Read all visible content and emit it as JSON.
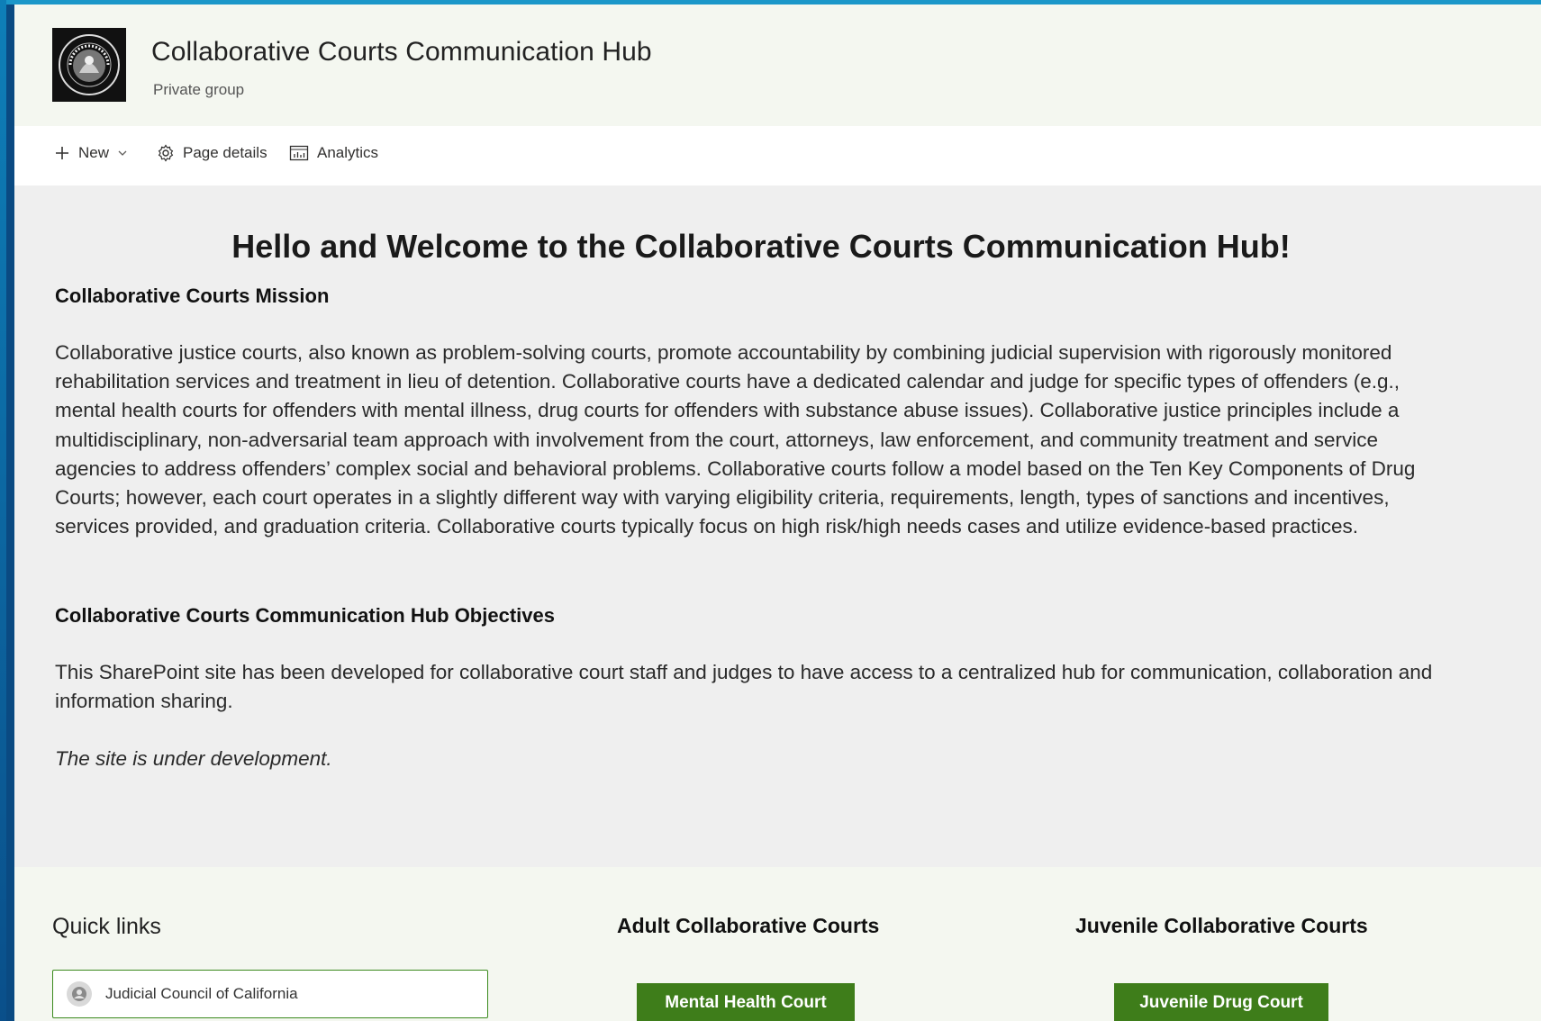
{
  "site": {
    "title": "Collaborative Courts Communication Hub",
    "subtitle": "Private group"
  },
  "command_bar": {
    "new_label": "New",
    "page_details_label": "Page details",
    "analytics_label": "Analytics"
  },
  "main": {
    "welcome": "Hello and Welcome to the Collaborative Courts Communication Hub!",
    "mission_heading": "Collaborative Courts Mission",
    "mission_text": "Collaborative justice courts, also known as problem-solving courts, promote accountability by combining judicial supervision with rigorously monitored rehabilitation services and treatment in lieu of detention. Collaborative courts have a dedicated calendar and judge for specific types of offenders (e.g., mental health courts for offenders with mental illness, drug courts for offenders with substance abuse issues). Collaborative justice principles include a multidisciplinary, non-adversarial team approach with involvement from the court, attorneys, law enforcement, and community treatment and service agencies to address offenders’ complex social and behavioral problems. Collaborative courts follow a model based on the Ten Key Components of Drug Courts; however, each court operates in a slightly different way with varying eligibility criteria, requirements, length, types of sanctions and incentives, services provided, and graduation criteria. Collaborative courts typically focus on high risk/high needs cases and utilize evidence-based practices.",
    "objectives_heading": "Collaborative Courts Communication Hub Objectives",
    "objectives_text": "This SharePoint site has been developed for collaborative court staff and judges to have access to a centralized hub for communication, collaboration and information sharing.",
    "development_note": "The site is under development."
  },
  "quick_links": {
    "title": "Quick links",
    "items": [
      {
        "label": "Judicial Council of California",
        "icon": "court-seal-icon"
      }
    ]
  },
  "adult": {
    "title": "Adult Collaborative Courts",
    "button": "Mental Health Court"
  },
  "juvenile": {
    "title": "Juvenile Collaborative Courts",
    "button": "Juvenile Drug Court"
  },
  "colors": {
    "header_bg": "#f4f7f0",
    "content_bg": "#efefef",
    "accent_green": "#3e7d1a",
    "frame_blue": "#1b97c9"
  }
}
